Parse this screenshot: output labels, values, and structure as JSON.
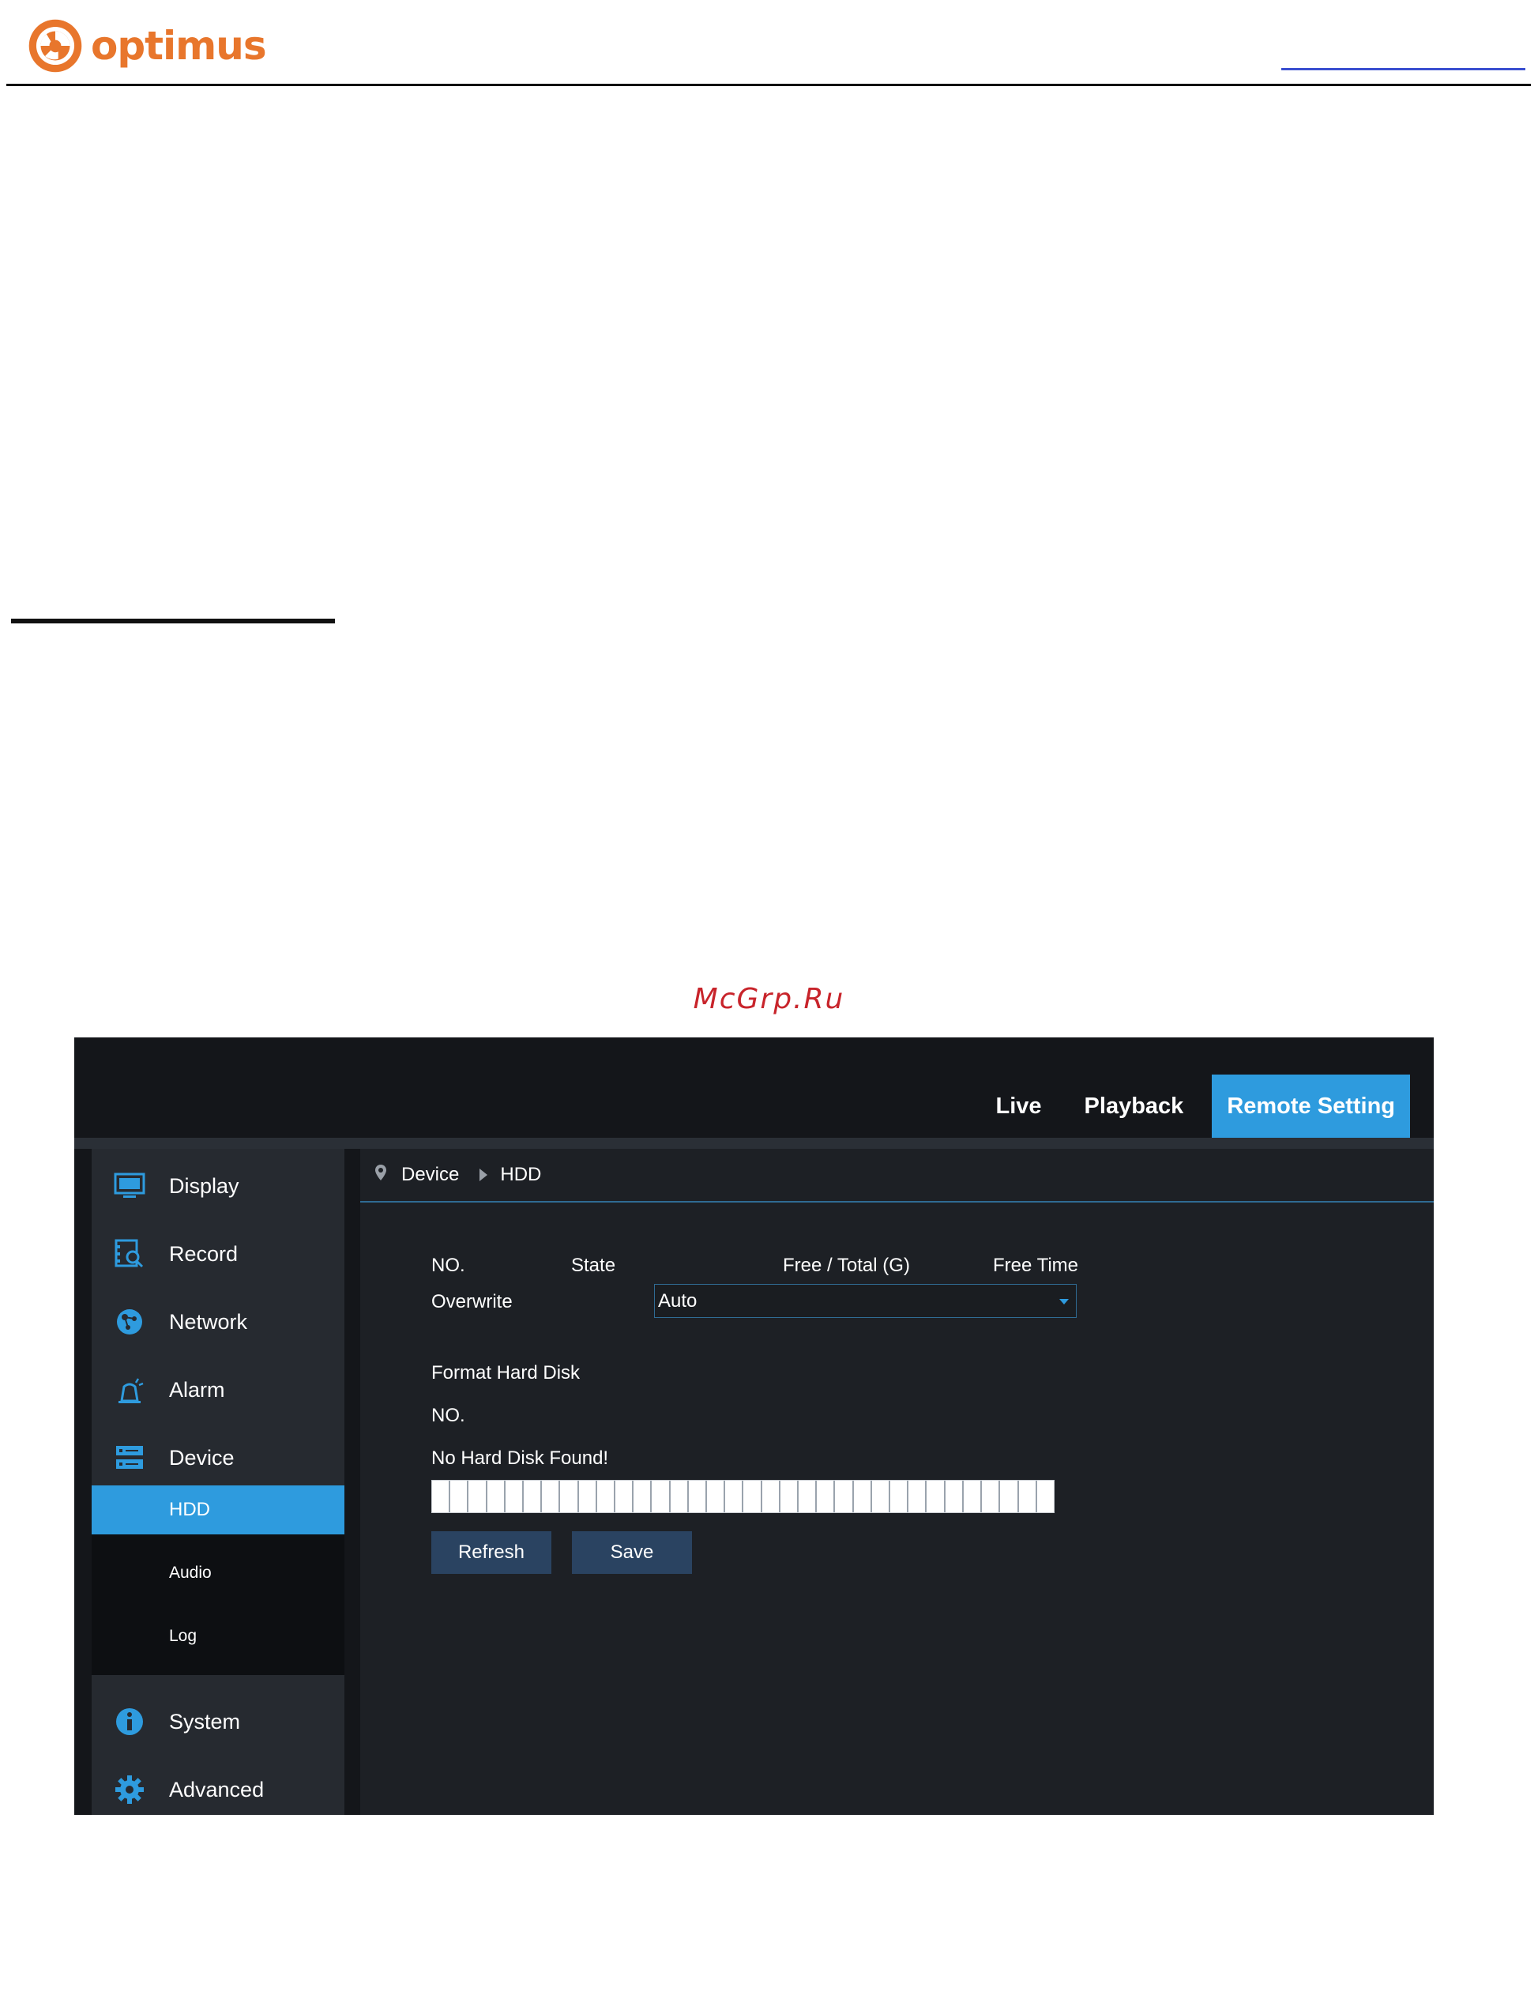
{
  "document": {
    "brand_name": "optimus",
    "watermark": "McGrp.Ru"
  },
  "dvr": {
    "nav": [
      {
        "label": "Live",
        "active": false
      },
      {
        "label": "Playback",
        "active": false
      },
      {
        "label": "Remote Setting",
        "active": true
      }
    ],
    "sidebar": {
      "items": [
        {
          "label": "Display",
          "icon": "monitor-icon"
        },
        {
          "label": "Record",
          "icon": "record-search-icon"
        },
        {
          "label": "Network",
          "icon": "network-icon"
        },
        {
          "label": "Alarm",
          "icon": "alarm-icon"
        },
        {
          "label": "Device",
          "icon": "device-icon"
        },
        {
          "label": "System",
          "icon": "info-icon"
        },
        {
          "label": "Advanced",
          "icon": "gear-icon"
        }
      ],
      "subitems": [
        {
          "label": "HDD",
          "active": true
        },
        {
          "label": "Audio",
          "active": false
        },
        {
          "label": "Log",
          "active": false
        }
      ]
    },
    "breadcrumb": {
      "parent": "Device",
      "current": "HDD"
    },
    "hdd": {
      "columns": [
        "NO.",
        "State",
        "Free / Total (G)",
        "Free Time"
      ],
      "overwrite_label": "Overwrite",
      "overwrite_value": "Auto",
      "format_label": "Format Hard Disk",
      "format_no_label": "NO.",
      "status_message": "No Hard Disk Found!",
      "refresh_label": "Refresh",
      "save_label": "Save"
    },
    "colors": {
      "accent": "#2e9bde",
      "background": "#14161a",
      "panel": "#1d2025",
      "button": "#2a4361"
    }
  }
}
